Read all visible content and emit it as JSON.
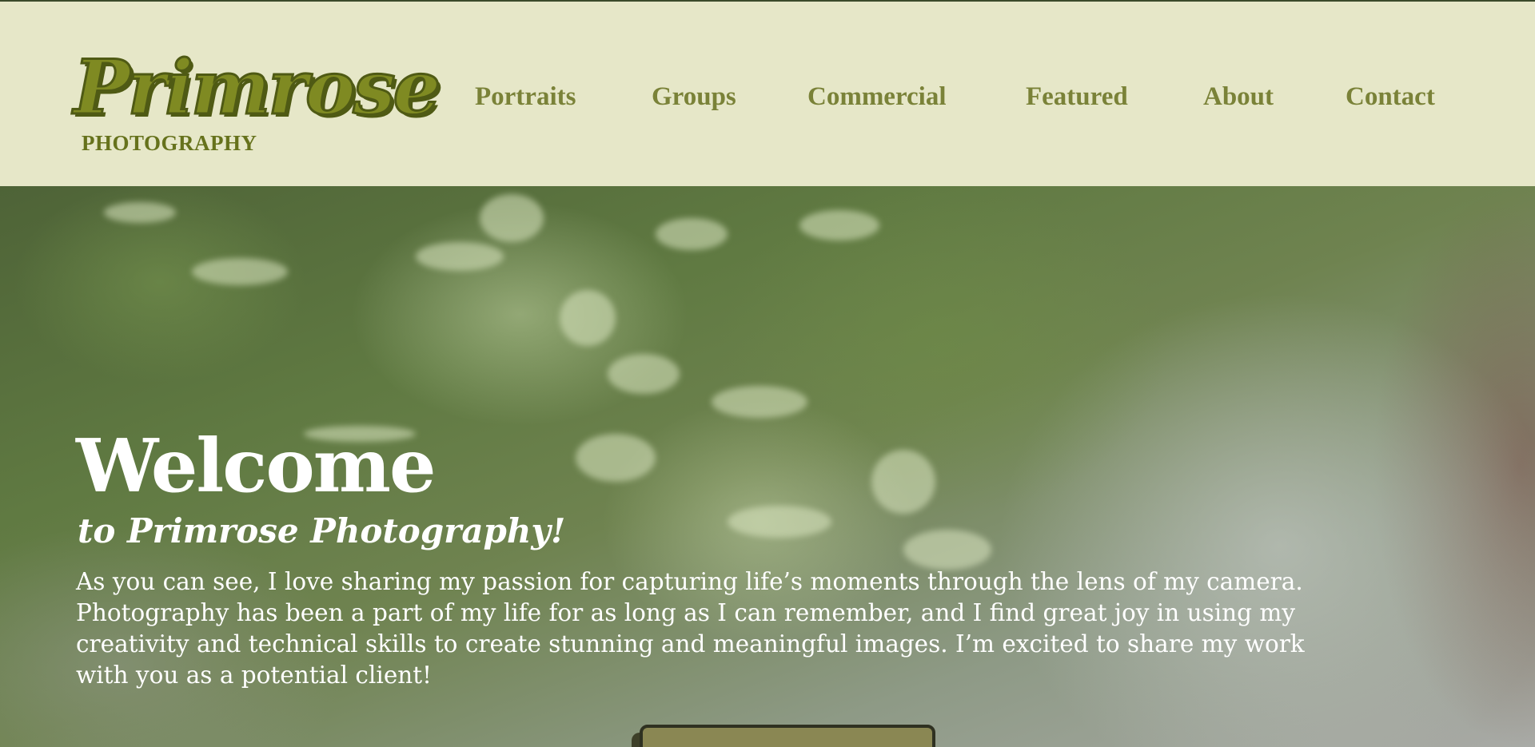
{
  "header": {
    "logo": {
      "script_text": "Primrose",
      "subtitle": "PHOTOGRAPHY"
    },
    "nav": [
      {
        "label": "Portraits"
      },
      {
        "label": "Groups"
      },
      {
        "label": "Commercial"
      },
      {
        "label": "Featured"
      },
      {
        "label": "About"
      },
      {
        "label": "Contact"
      }
    ]
  },
  "hero": {
    "title": "Welcome",
    "subtitle": "to Primrose Photography!",
    "body": "As you can see, I love sharing my passion for capturing life’s moments through the lens of my camera. Photography has been a part of my life for as long as I can remember, and I find great joy in using my creativity and technical skills to create stunning and meaningful images. I’m excited to share my work with you as a potential client!"
  },
  "colors": {
    "header_background": "#e6e7c8",
    "logo_green": "#7f8a22",
    "nav_text": "#7a8238",
    "hero_text": "#ffffff",
    "button_fill": "#8a8753",
    "button_border": "#2f3121"
  }
}
